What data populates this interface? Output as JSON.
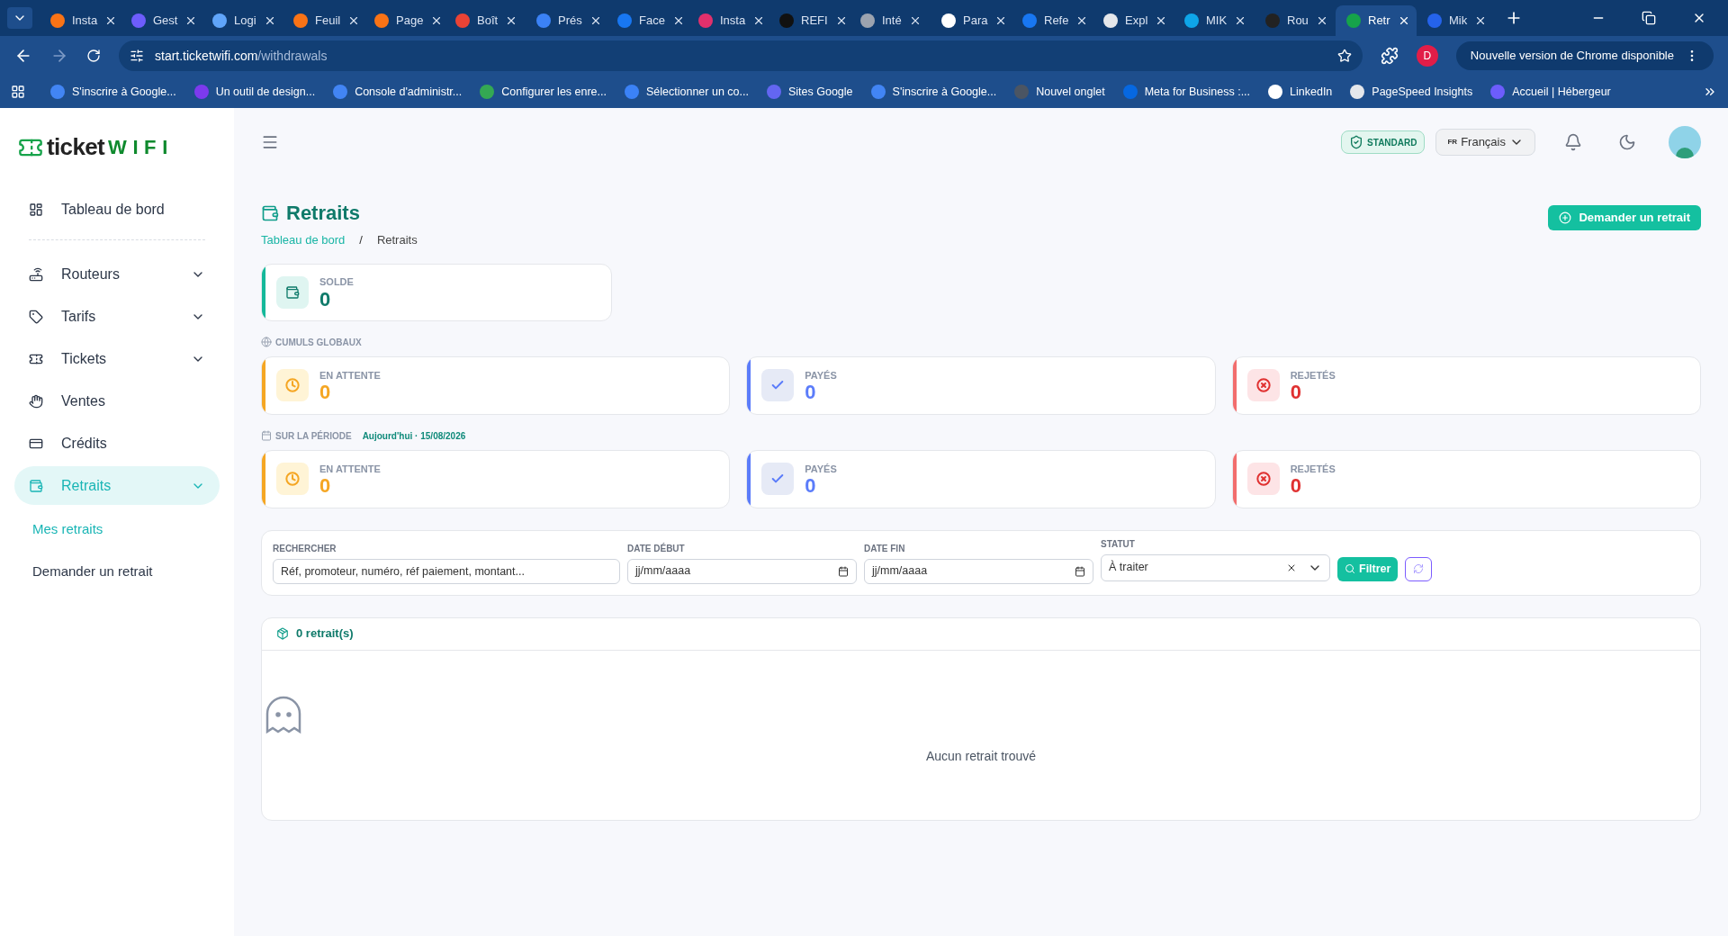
{
  "browser": {
    "tabs": [
      {
        "title": "Insta",
        "color": "#f97316",
        "selected": false
      },
      {
        "title": "Gest",
        "color": "#6d5dfc",
        "selected": false
      },
      {
        "title": "Logi",
        "color": "#60a5fa",
        "selected": false
      },
      {
        "title": "Feuil",
        "color": "#f97316",
        "selected": false
      },
      {
        "title": "Page",
        "color": "#f97316",
        "selected": false
      },
      {
        "title": "Boît",
        "color": "#ea4335",
        "selected": false
      },
      {
        "title": "Prés",
        "color": "#3b82f6",
        "selected": false
      },
      {
        "title": "Face",
        "color": "#1877f2",
        "selected": false
      },
      {
        "title": "Insta",
        "color": "#e1306c",
        "selected": false
      },
      {
        "title": "REFI",
        "color": "#111111",
        "selected": false
      },
      {
        "title": "Inté",
        "color": "#9ca3af",
        "selected": false
      },
      {
        "title": "Para",
        "color": "#ffffff",
        "selected": false
      },
      {
        "title": "Refe",
        "color": "#1877f2",
        "selected": false
      },
      {
        "title": "Expl",
        "color": "#e5e7eb",
        "selected": false
      },
      {
        "title": "MIK",
        "color": "#0ea5e9",
        "selected": false
      },
      {
        "title": "Rou",
        "color": "#222222",
        "selected": false
      },
      {
        "title": "Retr",
        "color": "#16a34a",
        "selected": true
      },
      {
        "title": "Mik",
        "color": "#2563eb",
        "selected": false
      }
    ],
    "url_host": "start.ticketwifi.com",
    "url_path": "/withdrawals",
    "profile_initial": "D",
    "update_notice": "Nouvelle version de Chrome disponible",
    "bookmarks": [
      {
        "title": "S'inscrire à Google...",
        "color": "#4285f4"
      },
      {
        "title": "Un outil de design...",
        "color": "#7c3aed"
      },
      {
        "title": "Console d'administr...",
        "color": "#4285f4"
      },
      {
        "title": "Configurer les enre...",
        "color": "#34a853"
      },
      {
        "title": "Sélectionner un co...",
        "color": "#3b82f6"
      },
      {
        "title": "Sites Google",
        "color": "#6366f1"
      },
      {
        "title": "S'inscrire à Google...",
        "color": "#4285f4"
      },
      {
        "title": "Nouvel onglet",
        "color": "#4b5563"
      },
      {
        "title": "Meta for Business :...",
        "color": "#0668e1"
      },
      {
        "title": "LinkedIn",
        "color": "#ffffff"
      },
      {
        "title": "PageSpeed Insights",
        "color": "#e5e7eb"
      },
      {
        "title": "Accueil | Hébergeur",
        "color": "#6d5dfc"
      }
    ]
  },
  "sidebar": {
    "logo_a": "ticket",
    "logo_b": "WIFI",
    "items": [
      {
        "label": "Tableau de bord",
        "expandable": false,
        "selected": false
      },
      {
        "label": "Routeurs",
        "expandable": true,
        "selected": false
      },
      {
        "label": "Tarifs",
        "expandable": true,
        "selected": false
      },
      {
        "label": "Tickets",
        "expandable": true,
        "selected": false
      },
      {
        "label": "Ventes",
        "expandable": false,
        "selected": false
      },
      {
        "label": "Crédits",
        "expandable": false,
        "selected": false
      },
      {
        "label": "Retraits",
        "expandable": true,
        "selected": true,
        "children": [
          {
            "label": "Mes retraits",
            "selected": true
          },
          {
            "label": "Demander un retrait",
            "selected": false
          }
        ]
      }
    ]
  },
  "topbar": {
    "plan": "STANDARD",
    "language_code": "FR",
    "language": "Français"
  },
  "page": {
    "title": "Retraits",
    "breadcrumb": [
      "Tableau de bord",
      "Retraits"
    ],
    "breadcrumb_separator": "/",
    "action": "Demander un retrait"
  },
  "balance": {
    "label": "SOLDE",
    "value": "0"
  },
  "sections": [
    {
      "kind": "global",
      "title": "CUMULS GLOBAUX",
      "cards": [
        {
          "kind": "pending",
          "label": "EN ATTENTE",
          "value": "0"
        },
        {
          "kind": "paid",
          "label": "PAYÉS",
          "value": "0"
        },
        {
          "kind": "rejected",
          "label": "REJETÉS",
          "value": "0"
        }
      ]
    },
    {
      "kind": "period",
      "title": "SUR LA PÉRIODE",
      "period": "Aujourd'hui · 15/08/2026",
      "cards": [
        {
          "kind": "pending",
          "label": "EN ATTENTE",
          "value": "0"
        },
        {
          "kind": "paid",
          "label": "PAYÉS",
          "value": "0"
        },
        {
          "kind": "rejected",
          "label": "REJETÉS",
          "value": "0"
        }
      ]
    }
  ],
  "filters": {
    "search_label": "RECHERCHER",
    "search_placeholder": "Réf, promoteur, numéro, réf paiement, montant...",
    "start_label": "DATE DÉBUT",
    "start_placeholder": "jj/mm/aaaa",
    "end_label": "DATE FIN",
    "end_placeholder": "jj/mm/aaaa",
    "status_label": "STATUT",
    "status_value": "À traiter",
    "filter_button": "Filtrer"
  },
  "results": {
    "count": "0 retrait(s)",
    "empty": "Aucun retrait trouvé"
  }
}
